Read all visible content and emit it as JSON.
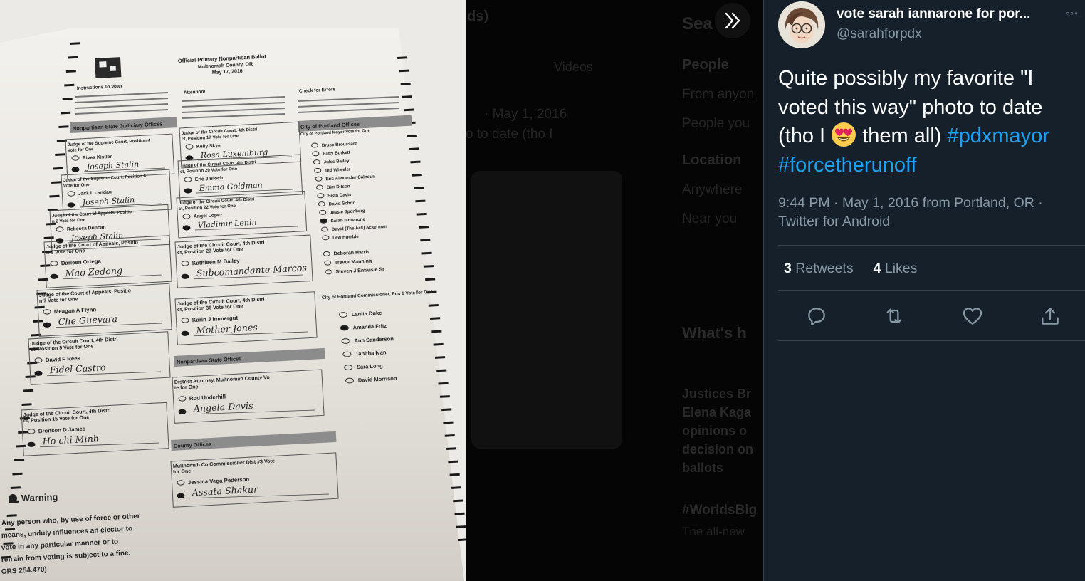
{
  "tweet": {
    "author_name": "vote sarah iannarone for por...",
    "author_handle": "@sarahforpdx",
    "more_label": "◦◦◦",
    "text_before_emoji": "Quite possibly my favorite \"I voted this way\" photo  to date (tho I ",
    "text_after_emoji": " them all) ",
    "hashtag_1": "#pdxmayor",
    "hashtag_2": "#forcetherunoff",
    "emoji": "heart-eyes-emoji",
    "timestamp": "9:44 PM · May 1, 2016 from Portland, OR · Twitter for Android",
    "retweets_count": "3",
    "retweets_label": "Retweets",
    "likes_count": "4",
    "likes_label": "Likes",
    "icons": {
      "reply": "reply-icon",
      "retweet": "retweet-icon",
      "like": "heart-icon",
      "share": "share-icon",
      "expand": "chevrons-right-icon"
    }
  },
  "background": {
    "search_title": "Sea",
    "tabs_fragment": "ds)",
    "videos_tab": "Videos",
    "people_label": "People",
    "from_anyone": "From anyon",
    "people_you": "People you",
    "location_label": "Location",
    "anywhere": "Anywhere",
    "near_you": "Near you",
    "blurred_date": "· May 1, 2016",
    "blurred_text": "o  to date (tho I",
    "whats_happening": "What's h",
    "trend_1": "Justices Br",
    "trend_2": "Elena Kaga",
    "trend_3": "opinions o",
    "trend_4": "decision on",
    "trend_5": "ballots",
    "trend_tag": "#WorldsBig",
    "trend_sub": "The all-new"
  },
  "ballot": {
    "title_line_1": "Official Primary Nonpartisan Ballot",
    "title_line_2": "Multnomah County, OR",
    "title_line_3": "May 17, 2016",
    "instructions": "Instructions To Voter",
    "attention": "Attention!",
    "check_errors": "Check for Errors",
    "judiciary_header": "Nonpartisan State Judiciary Offices",
    "portland_header": "City of Portland Offices",
    "state_offices_header": "Nonpartisan State Offices",
    "county_offices_header": "County Offices",
    "mayor_race": "City of Portland Mayor Vote for One",
    "commissioner_race": "City of Portland Commissioner, Pos 1 Vote for One",
    "mayor_candidates": [
      "Bruce Broussard",
      "Patty Burkett",
      "Jules Bailey",
      "Ted Wheeler",
      "Eric Alexander Calhoun",
      "Bim Ditson",
      "Sean Davis",
      "David Schor",
      "Jessie Sponberg",
      "Sarah Iannarone",
      "David (The Ack) Ackerman",
      "Lew Humble",
      "Deborah Harris",
      "Trevor Manning",
      "Steven J Entwisle Sr"
    ],
    "commissioner_candidates": [
      "Lanita Duke",
      "Amanda Fritz",
      "Ann Sanderson",
      "Tabitha Ivan",
      "Sara Long",
      "David Morrison"
    ],
    "left_races": [
      {
        "race": "Judge of the Supreme Court, Position 4 Vote for One",
        "candidate": "Rives Kistler",
        "write_in": "Joseph Stalin"
      },
      {
        "race": "Judge of the Supreme Court, Position 6 Vote for One",
        "candidate": "Jack L Landau",
        "write_in": "Joseph Stalin"
      },
      {
        "race": "Judge of the Court of Appeals, Position 2 Vote for One",
        "candidate": "Rebecca Duncan",
        "write_in": "Joseph Stalin"
      },
      {
        "race": "Judge of the Court of Appeals, Position 3 Vote for One",
        "candidate": "Darleen Ortega",
        "write_in": "Mao Zedong"
      },
      {
        "race": "Judge of the Court of Appeals, Position 7 Vote for One",
        "candidate": "Meagan A Flynn",
        "write_in": "Che Guevara"
      },
      {
        "race": "Judge of the Circuit Court, 4th District, Position 9 Vote for One",
        "candidate": "David F Rees",
        "write_in": "Fidel Castro"
      },
      {
        "race": "Judge of the Circuit Court, 4th District, Position 15 Vote for One",
        "candidate": "Bronson D James",
        "write_in": "Ho chi Minh"
      }
    ],
    "middle_races": [
      {
        "race": "Judge of the Circuit Court, 4th District, Position 17 Vote for One",
        "candidate": "Kelly Skye",
        "write_in": "Rosa Luxemburg"
      },
      {
        "race": "Judge of the Circuit Court, 4th District, Position 20 Vote for One",
        "candidate": "Eric J Bloch",
        "write_in": "Emma Goldman"
      },
      {
        "race": "Judge of the Circuit Court, 4th District, Position 22 Vote for One",
        "candidate": "Angel Lopez",
        "write_in": "Vladimir Lenin"
      },
      {
        "race": "Judge of the Circuit Court, 4th District, Position 23 Vote for One",
        "candidate": "Kathleen M Dailey",
        "write_in": "Subcomandante Marcos"
      },
      {
        "race": "Judge of the Circuit Court, 4th District, Position 36 Vote for One",
        "candidate": "Karin J Immergut",
        "write_in": "Mother Jones"
      },
      {
        "race": "District Attorney, Multnomah County Vote for One",
        "candidate": "Rod Underhill",
        "write_in": "Angela Davis"
      },
      {
        "race": "Multnomah Co Commissioner Dist #3 Vote for One",
        "candidate": "Jessica Vega Pederson",
        "write_in": "Assata Shakur"
      }
    ],
    "warning_title": "Warning",
    "warning_text": [
      "Any person who, by use of force or other",
      "means, unduly influences an elector to",
      "vote in any particular manner or to",
      "refrain from voting is subject to a fine.",
      "ORS 254.470)"
    ]
  }
}
